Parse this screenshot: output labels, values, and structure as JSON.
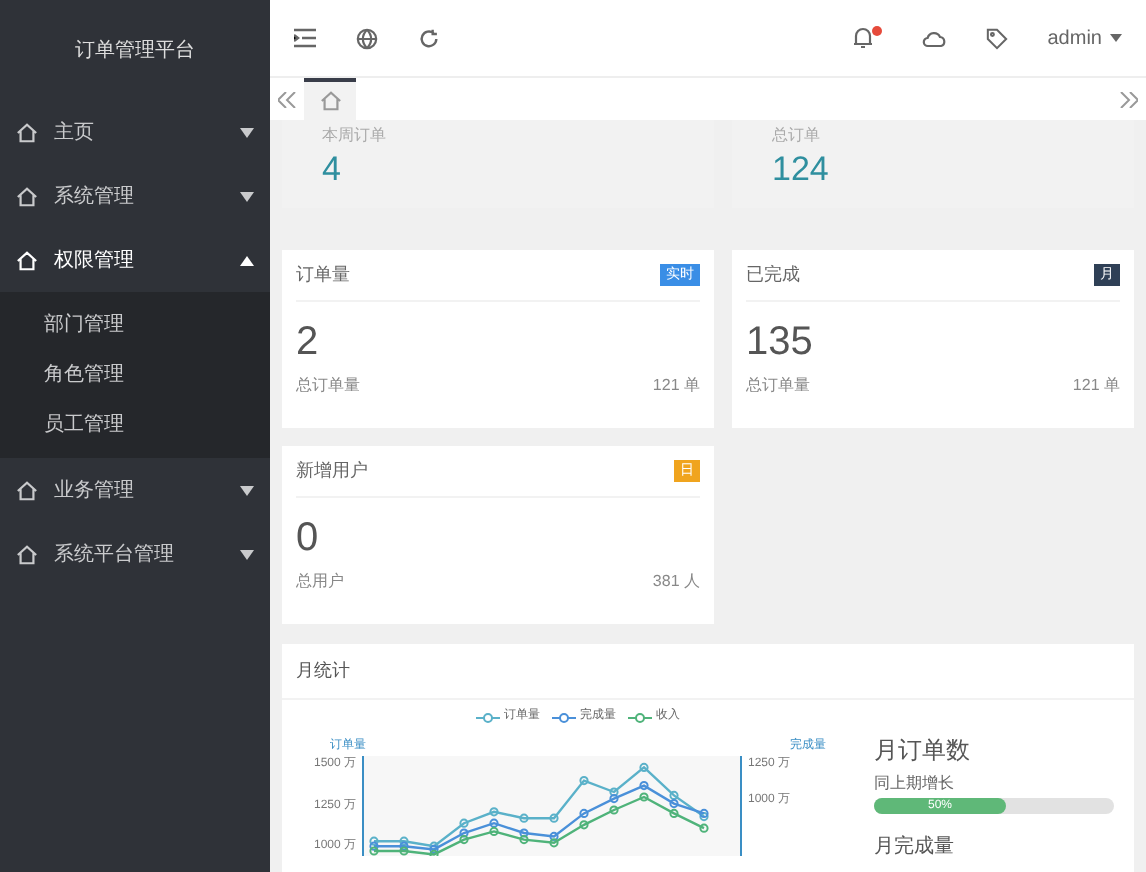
{
  "sidebar": {
    "title": "订单管理平台",
    "items": [
      {
        "label": "主页",
        "expanded": false
      },
      {
        "label": "系统管理",
        "expanded": false
      },
      {
        "label": "权限管理",
        "expanded": true,
        "children": [
          {
            "label": "部门管理"
          },
          {
            "label": "角色管理"
          },
          {
            "label": "员工管理"
          }
        ]
      },
      {
        "label": "业务管理",
        "expanded": false
      },
      {
        "label": "系统平台管理",
        "expanded": false
      }
    ]
  },
  "header": {
    "user": "admin",
    "notification": true
  },
  "tabs": [
    {
      "kind": "home",
      "selected": true
    }
  ],
  "summary_cards": [
    {
      "title": "本周订单",
      "value": "4"
    },
    {
      "title": "总订单",
      "value": "124"
    }
  ],
  "stat_cards": [
    {
      "title": "订单量",
      "badge": "实时",
      "color": "#3a8ee6",
      "value": "2",
      "footer_label": "总订单量",
      "footer_value": "121 单"
    },
    {
      "title": "已完成",
      "badge": "月",
      "color": "#2f4056",
      "value": "135",
      "footer_label": "总订单量",
      "footer_value": "121 单"
    },
    {
      "title": "新增用户",
      "badge": "日",
      "color": "#f0a41e",
      "value": "0",
      "footer_label": "总用户",
      "footer_value": "381 人"
    }
  ],
  "monthly": {
    "title": "月统计",
    "chart_data": {
      "type": "line",
      "ylabel": "订单量",
      "ylim": [
        940,
        1550
      ],
      "legend": "top",
      "yticks": [
        {
          "value": 1500,
          "label": "1500 万"
        },
        {
          "value": 1250,
          "label": "1250 万"
        },
        {
          "value": 1000,
          "label": "1000 万"
        }
      ],
      "series": [
        {
          "name": "订单量",
          "color": "#5ab1c9",
          "marker": "circle",
          "values": [
            1030,
            1030,
            1000,
            1140,
            1210,
            1170,
            1170,
            1400,
            1330,
            1480,
            1310,
            1180
          ]
        },
        {
          "name": "完成量",
          "color": "#4a90d9",
          "marker": "circle",
          "values": [
            1000,
            1000,
            980,
            1080,
            1140,
            1080,
            1060,
            1200,
            1290,
            1370,
            1260,
            1200
          ]
        },
        {
          "name": "收入",
          "color": "#4fb37a",
          "marker": "circle",
          "values": [
            970,
            970,
            950,
            1040,
            1090,
            1040,
            1020,
            1130,
            1220,
            1300,
            1200,
            1110
          ]
        }
      ]
    },
    "right_axis_title": "完成量",
    "right_ticks": [
      "1250 万",
      "1000 万"
    ],
    "side": {
      "title": "月订单数",
      "subtitle": "同上期增长",
      "level": 0.55,
      "reading": "50%"
    },
    "next_title": "月完成量"
  }
}
